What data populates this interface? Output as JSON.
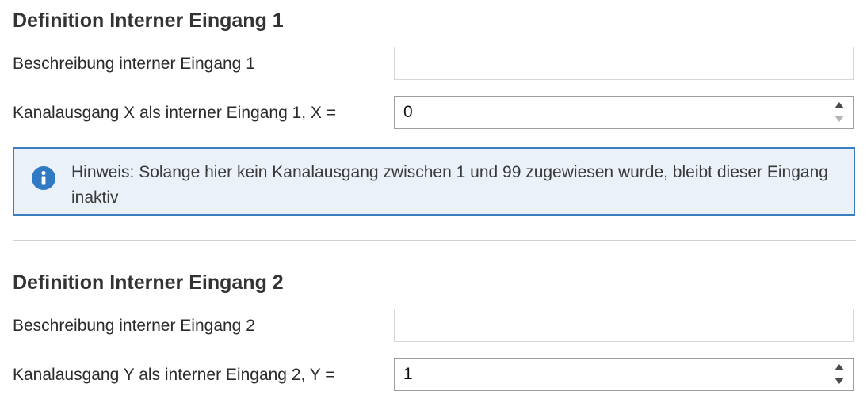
{
  "section1": {
    "title": "Definition Interner Eingang 1",
    "description_label": "Beschreibung interner Eingang 1",
    "description_value": "",
    "channel_label": "Kanalausgang X als interner Eingang 1, X =",
    "channel_value": "0",
    "hint": {
      "icon": "info-icon",
      "text": "Hinweis: Solange hier kein Kanalausgang zwischen 1 und 99 zugewiesen wurde, bleibt dieser Eingang inaktiv"
    }
  },
  "section2": {
    "title": "Definition Interner Eingang 2",
    "description_label": "Beschreibung interner Eingang 2",
    "description_value": "",
    "channel_label": "Kanalausgang Y als interner Eingang 2, Y =",
    "channel_value": "1"
  },
  "colors": {
    "hint_border": "#3a7dc0",
    "hint_background": "#eaf1f8",
    "info_icon": "#2f7ac2",
    "spinner_enabled": "#4a4a4a",
    "spinner_disabled": "#b5b5b5"
  }
}
